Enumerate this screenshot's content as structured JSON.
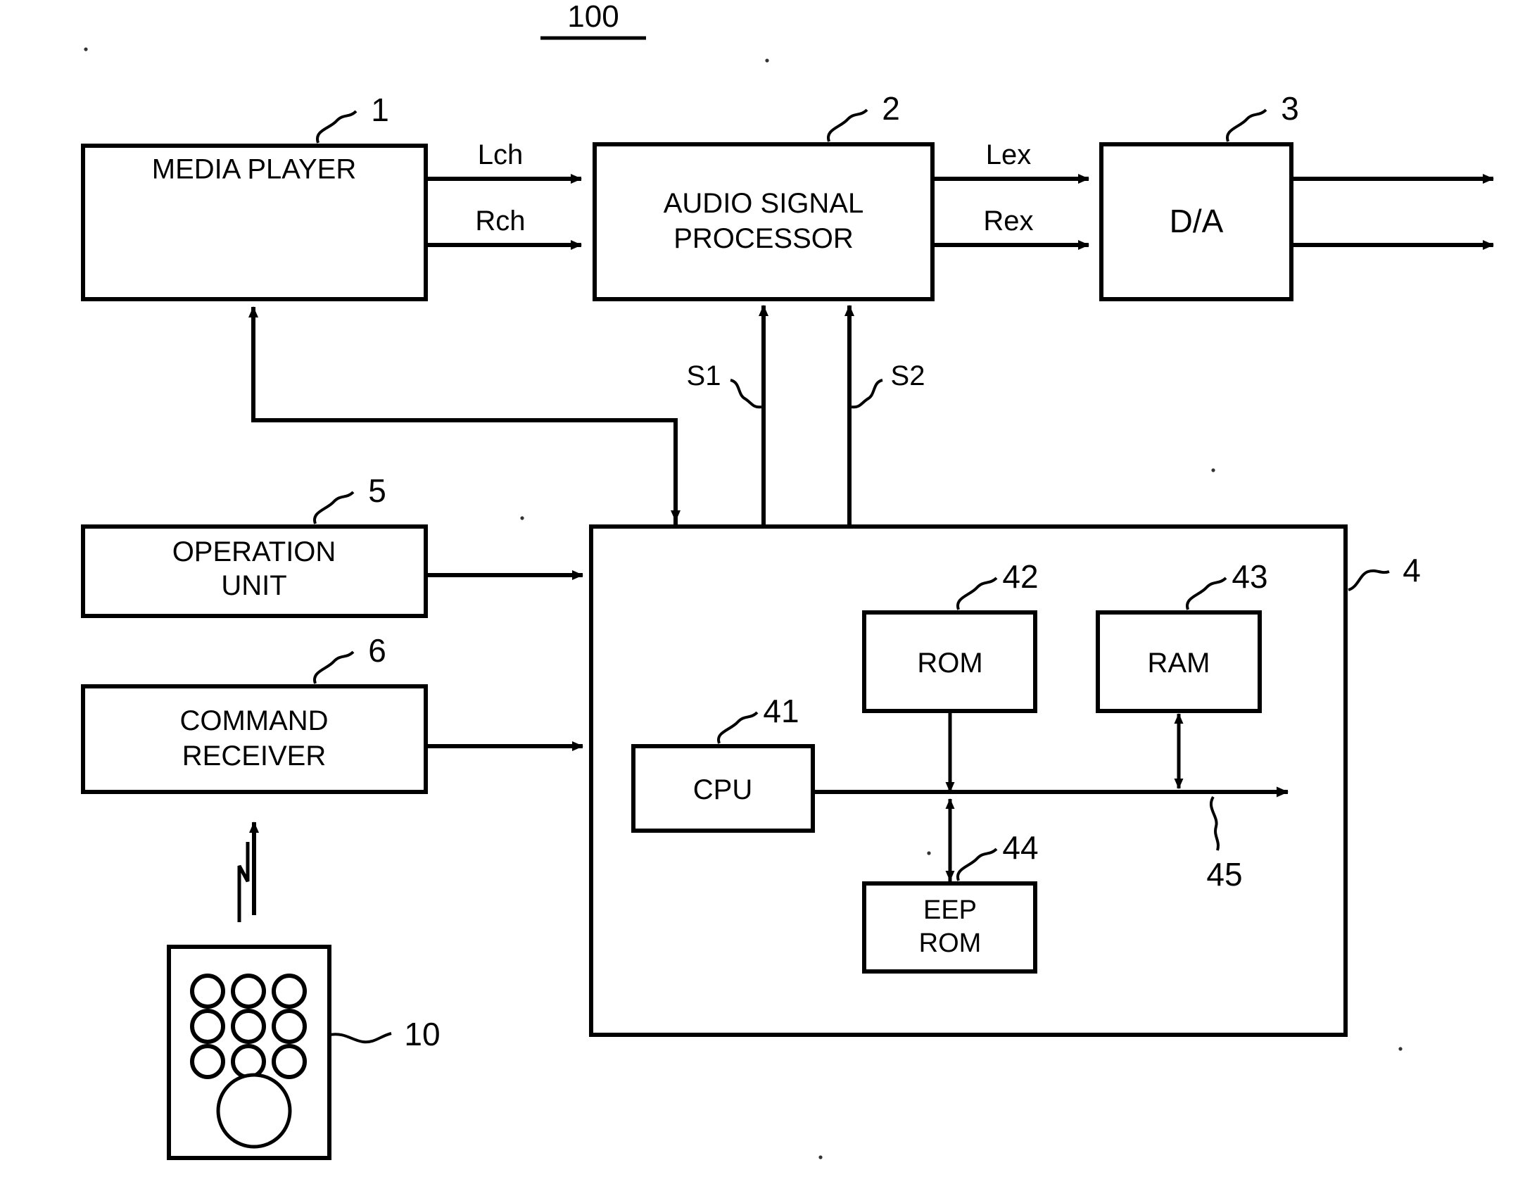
{
  "figure": {
    "title": "100",
    "title_underline": true
  },
  "blocks": {
    "media_player": {
      "label": "MEDIA PLAYER",
      "ref": "1"
    },
    "audio_signal_processor": {
      "label_line1": "AUDIO SIGNAL",
      "label_line2": "PROCESSOR",
      "ref": "2"
    },
    "da_converter": {
      "label": "D/A",
      "ref": "3"
    },
    "operation_unit": {
      "label_line1": "OPERATION",
      "label_line2": "UNIT",
      "ref": "5"
    },
    "command_receiver": {
      "label_line1": "COMMAND",
      "label_line2": "RECEIVER",
      "ref": "6"
    },
    "microcomputer": {
      "ref": "4"
    },
    "cpu": {
      "label": "CPU",
      "ref": "41"
    },
    "rom": {
      "label": "ROM",
      "ref": "42"
    },
    "ram": {
      "label": "RAM",
      "ref": "43"
    },
    "eeprom": {
      "label_line1": "EEP",
      "label_line2": "ROM",
      "ref": "44"
    },
    "bus": {
      "ref": "45"
    },
    "remote_control": {
      "ref": "10",
      "button_count": 10
    }
  },
  "signals": {
    "lch": "Lch",
    "rch": "Rch",
    "lex": "Lex",
    "rex": "Rex",
    "s1": "S1",
    "s2": "S2"
  },
  "colors": {
    "stroke": "#000000",
    "background": "#ffffff"
  }
}
